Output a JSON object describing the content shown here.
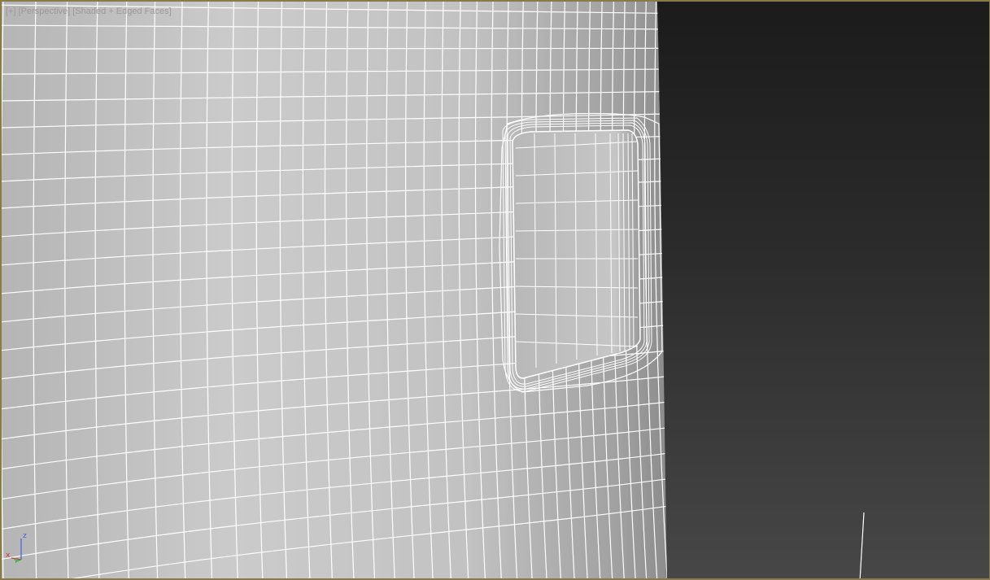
{
  "viewport": {
    "label_parts": [
      "[+]",
      "[Perspective]",
      "[Shaded + Edged Faces]"
    ],
    "background_top": "#1b1b1b",
    "background_bottom": "#474747",
    "active_border_color": "#8a7a4a",
    "wire_color": "#ffffff"
  },
  "axis_gizmo": {
    "x_label": "x",
    "y_label": "y",
    "z_label": "z",
    "x_color": "#d03030",
    "y_color": "#30b030",
    "z_color": "#4060e0"
  }
}
